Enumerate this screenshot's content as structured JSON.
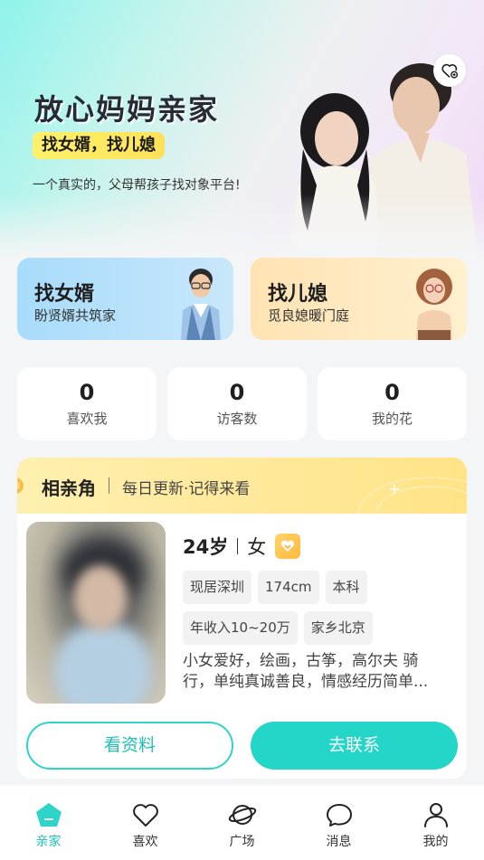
{
  "hero": {
    "title": "放心妈妈亲家",
    "tag": "找女婿，找儿媳",
    "subtitle": "一个真实的，父母帮孩子找对象平台!"
  },
  "find_cards": [
    {
      "title": "找女婿",
      "subtitle": "盼贤婿共筑家"
    },
    {
      "title": "找儿媳",
      "subtitle": "觅良媳暖门庭"
    }
  ],
  "stats": [
    {
      "value": "0",
      "label": "喜欢我"
    },
    {
      "value": "0",
      "label": "访客数"
    },
    {
      "value": "0",
      "label": "我的花"
    }
  ],
  "match": {
    "title": "相亲角",
    "subtitle": "每日更新·记得来看",
    "profile": {
      "age": "24岁",
      "gender": "女",
      "tags_row1": [
        "现居深圳",
        "174cm",
        "本科"
      ],
      "tags_row2": [
        "年收入10~20万",
        "家乡北京"
      ],
      "desc_line1": "小女爱好，绘画，古筝，高尔夫 骑",
      "desc_line2": "行，单纯真诚善良，情感经历简单..."
    },
    "view_button": "看资料",
    "contact_button": "去联系"
  },
  "nav": [
    {
      "label": "亲家",
      "icon": "home-icon",
      "active": true
    },
    {
      "label": "喜欢",
      "icon": "heart-icon"
    },
    {
      "label": "广场",
      "icon": "planet-icon"
    },
    {
      "label": "消息",
      "icon": "message-icon"
    },
    {
      "label": "我的",
      "icon": "profile-icon"
    }
  ],
  "colors": {
    "accent": "#24d6c8",
    "tag_yellow": "#ffe25a"
  }
}
